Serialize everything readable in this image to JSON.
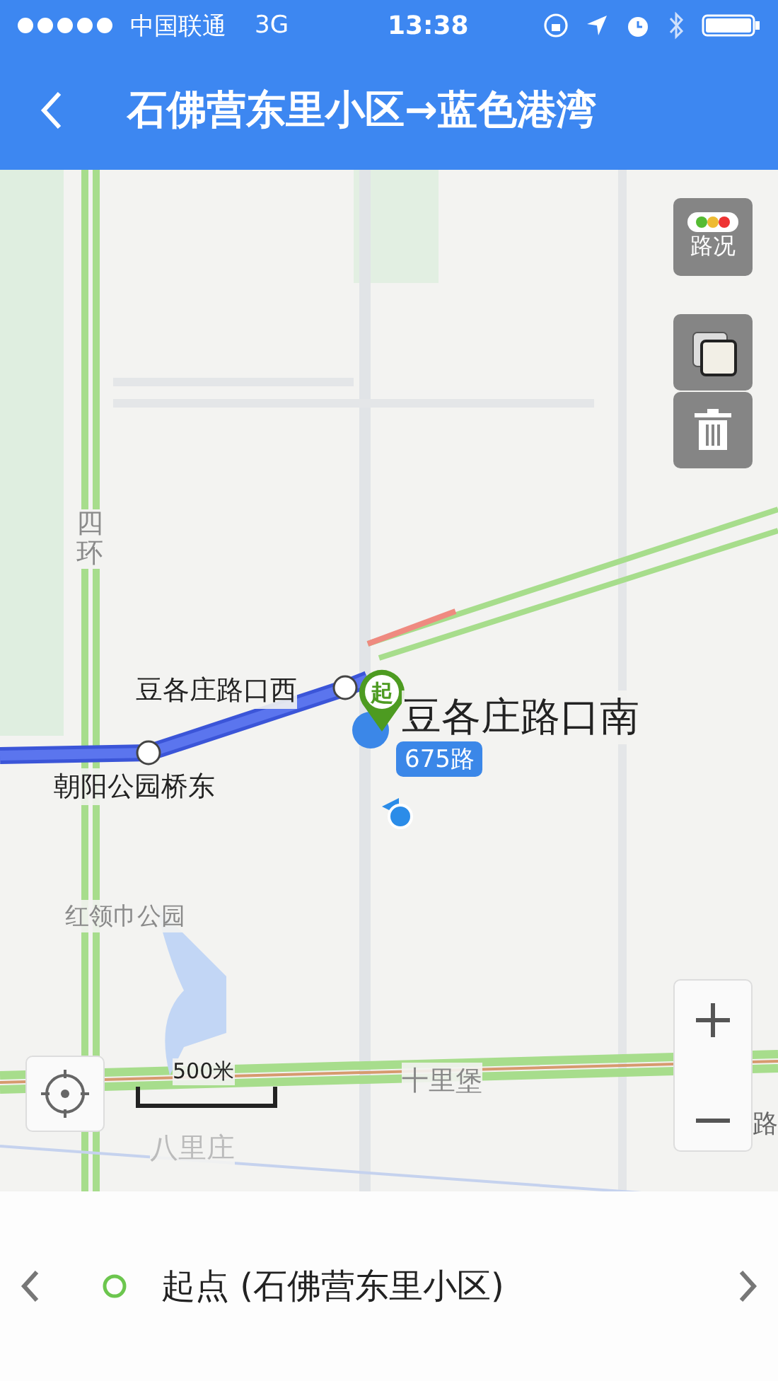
{
  "status_bar": {
    "carrier": "中国联通",
    "network": "3G",
    "time": "13:38"
  },
  "header": {
    "title": "石佛营东里小区→蓝色港湾"
  },
  "map": {
    "labels": [
      {
        "kind": "ring",
        "text": "四环"
      },
      {
        "kind": "stop",
        "text": "豆各庄路口西"
      },
      {
        "kind": "stop",
        "text": "朝阳公园桥东"
      },
      {
        "kind": "park",
        "text": "红领巾公园"
      },
      {
        "kind": "station",
        "text": "十里堡"
      },
      {
        "kind": "district",
        "text": "八里庄"
      },
      {
        "kind": "edge",
        "text": "路"
      }
    ],
    "start_marker": "起",
    "start_stop": "豆各庄路口南",
    "bus_line": "675路",
    "scale": "500米"
  },
  "controls": {
    "traffic_label": "路况"
  },
  "step_bar": {
    "text": "起点 (石佛营东里小区)"
  }
}
